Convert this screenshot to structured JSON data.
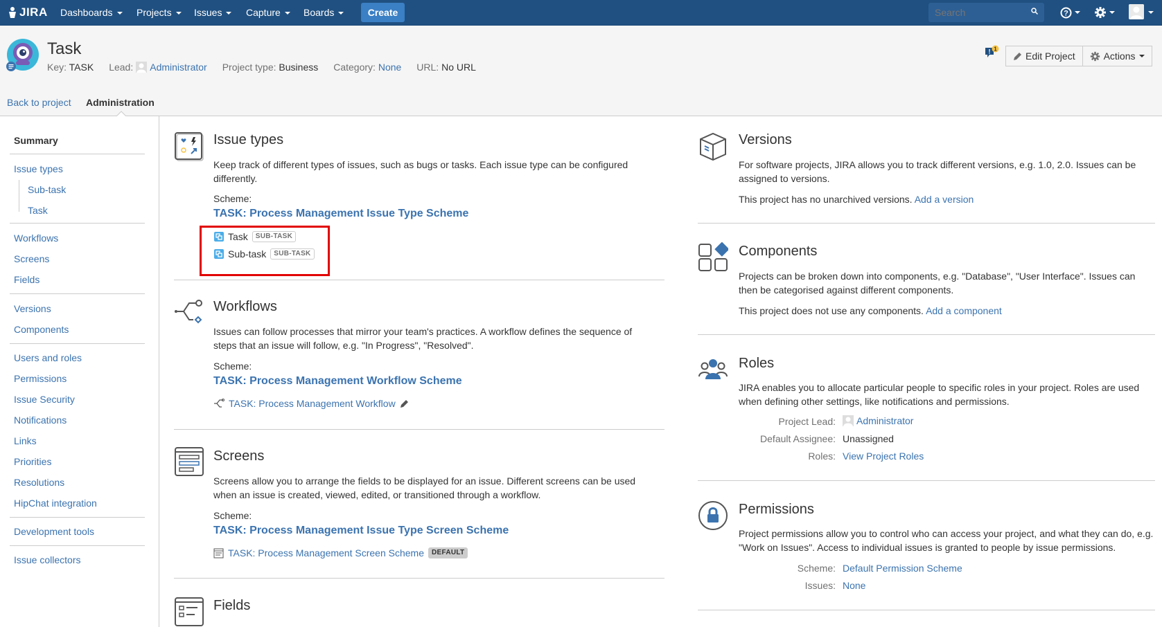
{
  "topnav": {
    "logo": "JIRA",
    "items": [
      {
        "label": "Dashboards"
      },
      {
        "label": "Projects"
      },
      {
        "label": "Issues"
      },
      {
        "label": "Capture"
      },
      {
        "label": "Boards"
      }
    ],
    "create_label": "Create",
    "search_placeholder": "Search",
    "accent": "#205081"
  },
  "project": {
    "title": "Task",
    "key_label": "Key:",
    "key": "TASK",
    "lead_label": "Lead:",
    "lead": "Administrator",
    "type_label": "Project type:",
    "type": "Business",
    "category_label": "Category:",
    "category": "None",
    "url_label": "URL:",
    "url": "No URL",
    "feedback_count": "1",
    "edit_label": "Edit Project",
    "actions_label": "Actions"
  },
  "tabs": {
    "back": "Back to project",
    "admin": "Administration"
  },
  "sidebar": {
    "summary": "Summary",
    "issue_types": "Issue types",
    "sub_task": "Sub-task",
    "task": "Task",
    "workflows": "Workflows",
    "screens": "Screens",
    "fields": "Fields",
    "versions": "Versions",
    "components": "Components",
    "users_roles": "Users and roles",
    "permissions": "Permissions",
    "issue_security": "Issue Security",
    "notifications": "Notifications",
    "links": "Links",
    "priorities": "Priorities",
    "resolutions": "Resolutions",
    "hipchat": "HipChat integration",
    "dev_tools": "Development tools",
    "issue_collectors": "Issue collectors"
  },
  "issue_types": {
    "title": "Issue types",
    "desc": "Keep track of different types of issues, such as bugs or tasks. Each issue type can be configured differently.",
    "scheme_label": "Scheme:",
    "scheme": "TASK: Process Management Issue Type Scheme",
    "items": [
      {
        "name": "Task",
        "badge": "SUB-TASK"
      },
      {
        "name": "Sub-task",
        "badge": "SUB-TASK"
      }
    ]
  },
  "workflows": {
    "title": "Workflows",
    "desc": "Issues can follow processes that mirror your team's practices. A workflow defines the sequence of steps that an issue will follow, e.g. \"In Progress\", \"Resolved\".",
    "scheme_label": "Scheme:",
    "scheme": "TASK: Process Management Workflow Scheme",
    "workflow": "TASK: Process Management Workflow"
  },
  "screens": {
    "title": "Screens",
    "desc": "Screens allow you to arrange the fields to be displayed for an issue. Different screens can be used when an issue is created, viewed, edited, or transitioned through a workflow.",
    "scheme_label": "Scheme:",
    "scheme": "TASK: Process Management Issue Type Screen Scheme",
    "screen": "TASK: Process Management Screen Scheme",
    "badge": "DEFAULT"
  },
  "fields": {
    "title": "Fields"
  },
  "versions": {
    "title": "Versions",
    "desc": "For software projects, JIRA allows you to track different versions, e.g. 1.0, 2.0. Issues can be assigned to versions.",
    "status": "This project has no unarchived versions.",
    "add": "Add a version"
  },
  "components": {
    "title": "Components",
    "desc": "Projects can be broken down into components, e.g. \"Database\", \"User Interface\". Issues can then be categorised against different components.",
    "status": "This project does not use any components.",
    "add": "Add a component"
  },
  "roles": {
    "title": "Roles",
    "desc": "JIRA enables you to allocate particular people to specific roles in your project. Roles are used when defining other settings, like notifications and permissions.",
    "lead_label": "Project Lead:",
    "lead": "Administrator",
    "assignee_label": "Default Assignee:",
    "assignee": "Unassigned",
    "roles_label": "Roles:",
    "roles_link": "View Project Roles"
  },
  "permissions": {
    "title": "Permissions",
    "desc": "Project permissions allow you to control who can access your project, and what they can do, e.g. \"Work on Issues\". Access to individual issues is granted to people by issue permissions.",
    "scheme_label": "Scheme:",
    "scheme": "Default Permission Scheme",
    "issues_label": "Issues:",
    "issues": "None"
  }
}
